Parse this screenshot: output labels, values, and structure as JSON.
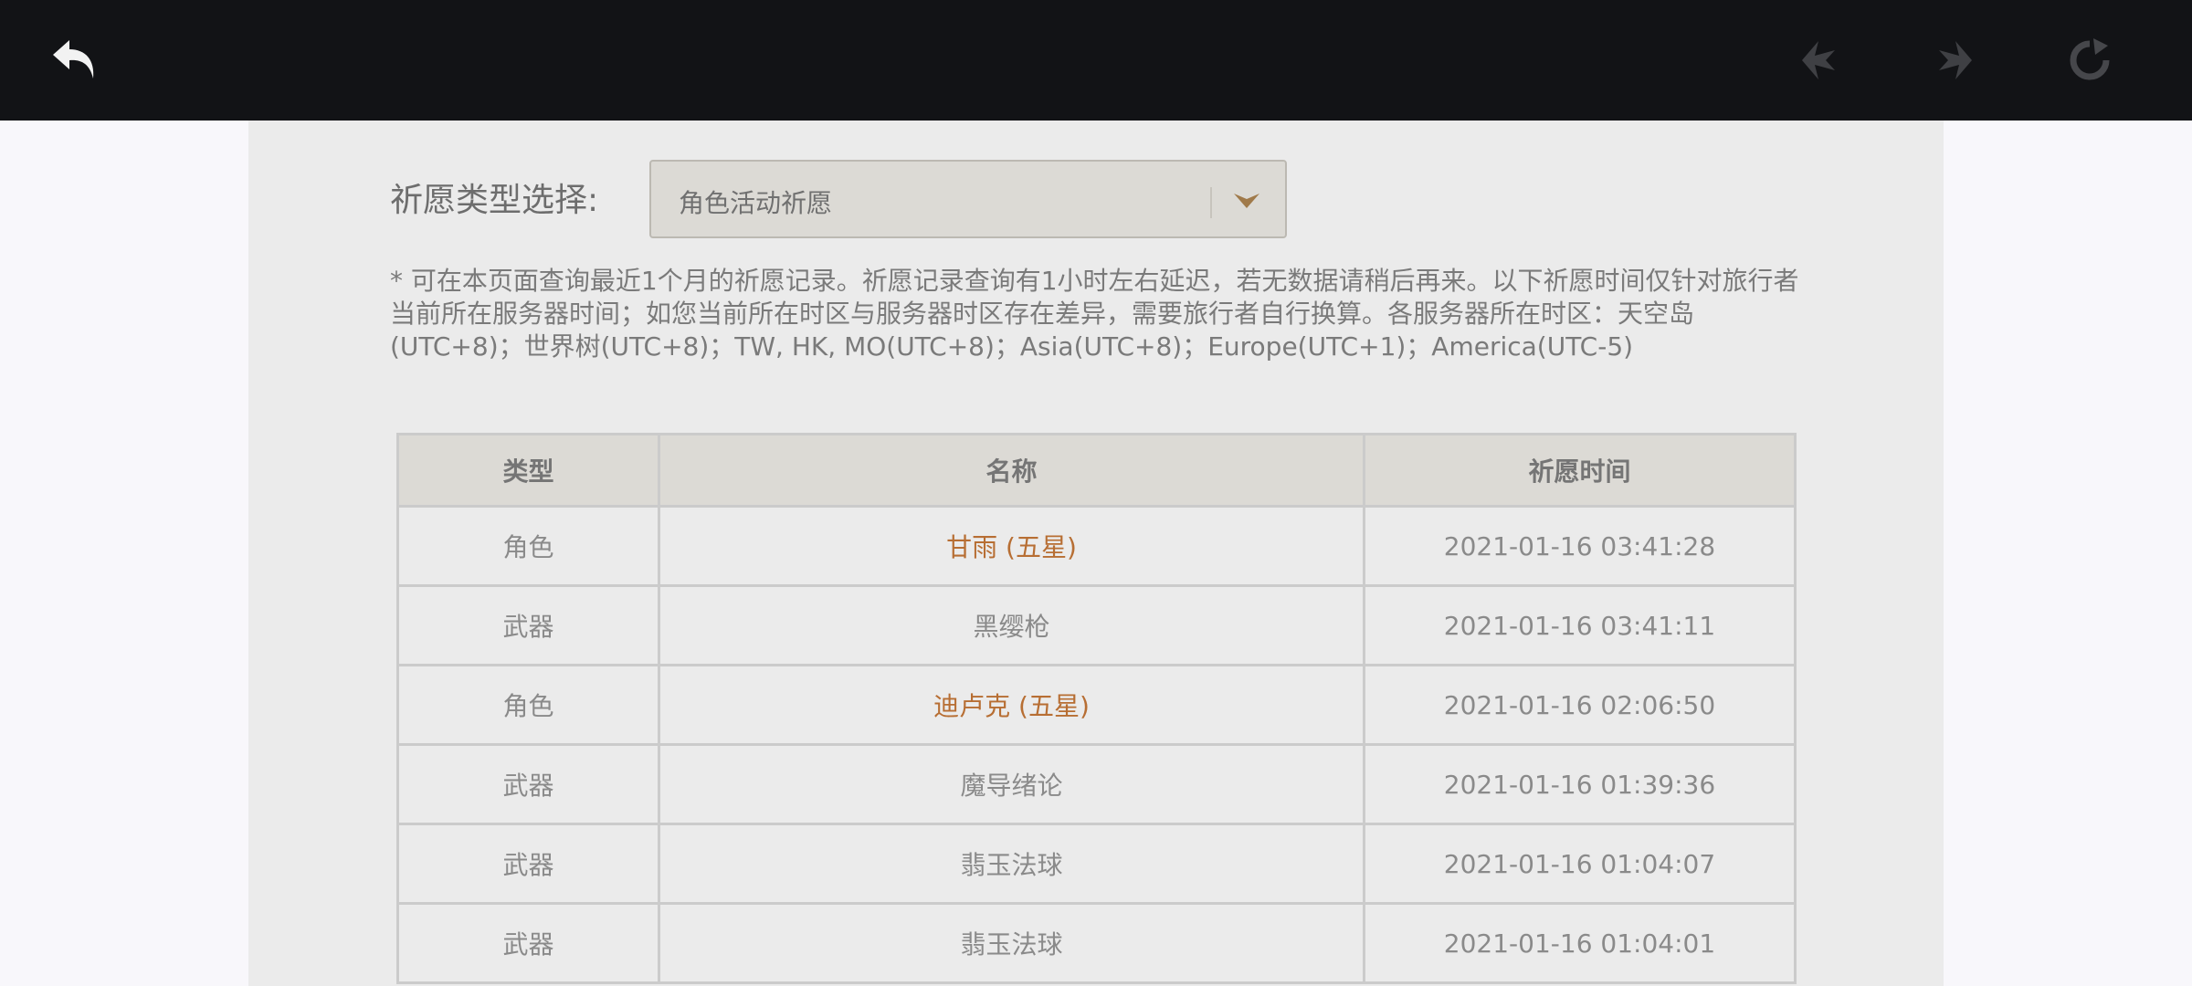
{
  "toolbar": {
    "back_icon": "back-arrow-icon",
    "prev_icon": "prev-diamond-icon",
    "next_icon": "next-diamond-icon",
    "refresh_icon": "refresh-icon",
    "background": "#121316"
  },
  "filter": {
    "label": "祈愿类型选择:",
    "selected": "角色活动祈愿"
  },
  "notice": "* 可在本页面查询最近1个月的祈愿记录。祈愿记录查询有1小时左右延迟，若无数据请稍后再来。以下祈愿时间仅针对旅行者当前所在服务器时间；如您当前所在时区与服务器时区存在差异，需要旅行者自行换算。各服务器所在时区：天空岛(UTC+8)；世界树(UTC+8)；TW, HK, MO(UTC+8)；Asia(UTC+8)；Europe(UTC+1)；America(UTC-5)",
  "table": {
    "headers": [
      "类型",
      "名称",
      "祈愿时间"
    ],
    "rows": [
      {
        "type": "角色",
        "name": "甘雨 (五星)",
        "time": "2021-01-16 03:41:28",
        "five_star": true
      },
      {
        "type": "武器",
        "name": "黑缨枪",
        "time": "2021-01-16 03:41:11",
        "five_star": false
      },
      {
        "type": "角色",
        "name": "迪卢克 (五星)",
        "time": "2021-01-16 02:06:50",
        "five_star": true
      },
      {
        "type": "武器",
        "name": "魔导绪论",
        "time": "2021-01-16 01:39:36",
        "five_star": false
      },
      {
        "type": "武器",
        "name": "翡玉法球",
        "time": "2021-01-16 01:04:07",
        "five_star": false
      },
      {
        "type": "武器",
        "name": "翡玉法球",
        "time": "2021-01-16 01:04:01",
        "five_star": false
      }
    ]
  },
  "colors": {
    "five_star_text": "#b76e33",
    "panel_bg": "#ebebeb",
    "header_bg": "#dcdad5"
  }
}
